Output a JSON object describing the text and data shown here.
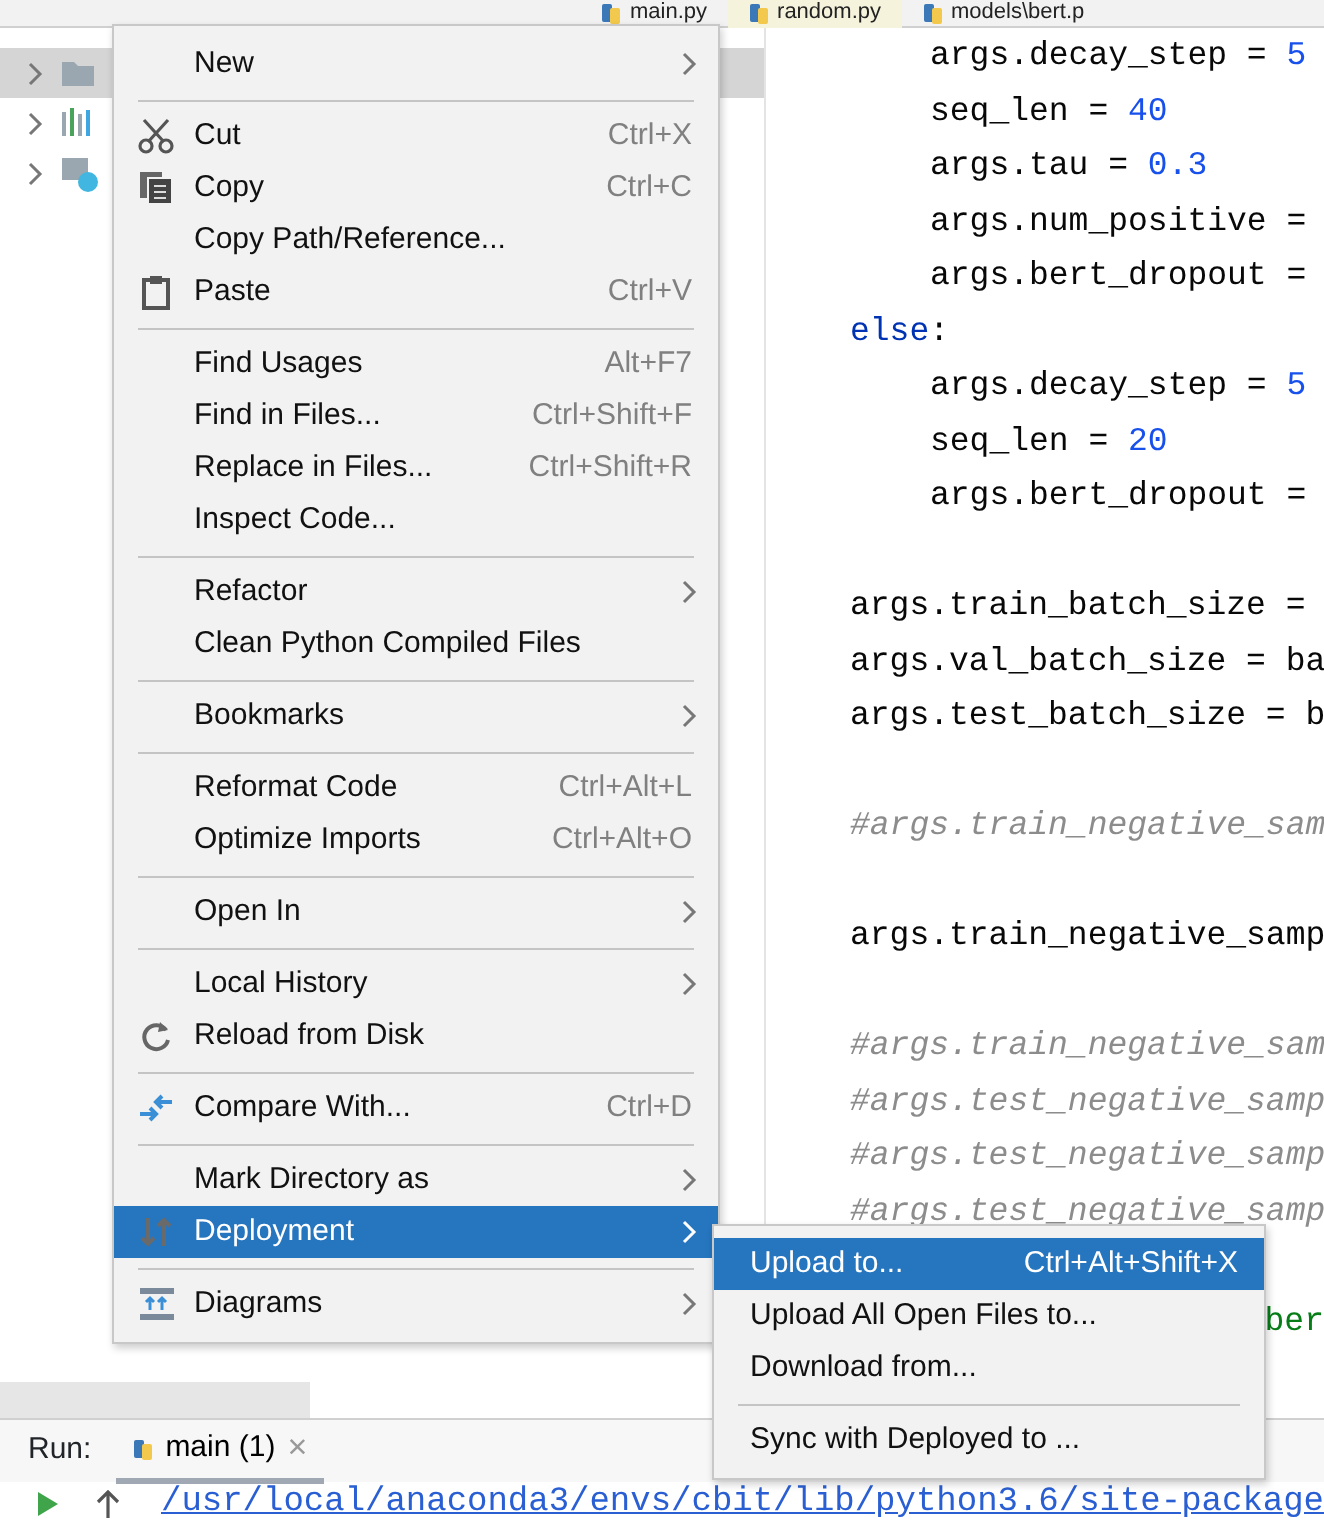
{
  "editor_tabs": [
    {
      "label": "main.py",
      "selected": false
    },
    {
      "label": "random.py",
      "selected": true
    },
    {
      "label": "models\\bert.p",
      "selected": false
    }
  ],
  "project_tree": [
    {
      "selected": true
    },
    {
      "selected": false
    },
    {
      "selected": false
    }
  ],
  "code_lines": [
    {
      "kind": "block",
      "children": [
        {
          "kind": "code",
          "tokens": [
            {
              "kind": "plain",
              "text": "args.decay_step = "
            },
            {
              "kind": "number",
              "text": "5"
            }
          ]
        },
        {
          "kind": "code",
          "tokens": [
            {
              "kind": "plain",
              "text": "seq_len = "
            },
            {
              "kind": "number",
              "text": "40"
            }
          ]
        },
        {
          "kind": "code",
          "tokens": [
            {
              "kind": "plain",
              "text": "args.tau = "
            },
            {
              "kind": "number",
              "text": "0.3"
            }
          ]
        },
        {
          "kind": "code",
          "tokens": [
            {
              "kind": "plain",
              "text": "args.num_positive ="
            }
          ]
        },
        {
          "kind": "code",
          "tokens": [
            {
              "kind": "plain",
              "text": "args.bert_dropout ="
            }
          ]
        }
      ]
    },
    {
      "kind": "code",
      "tokens": [
        {
          "kind": "keyword",
          "text": "else"
        },
        {
          "kind": "plain",
          "text": ":"
        }
      ],
      "children": [
        {
          "kind": "code",
          "tokens": [
            {
              "kind": "plain",
              "text": "args.decay_step = "
            },
            {
              "kind": "number",
              "text": "5"
            }
          ]
        },
        {
          "kind": "code",
          "tokens": [
            {
              "kind": "plain",
              "text": "seq_len = "
            },
            {
              "kind": "number",
              "text": "20"
            }
          ]
        },
        {
          "kind": "code",
          "tokens": [
            {
              "kind": "plain",
              "text": "args.bert_dropout ="
            }
          ]
        }
      ]
    },
    {
      "kind": "blank"
    },
    {
      "kind": "code",
      "tokens": [
        {
          "kind": "plain",
          "text": "args.train_batch_size ="
        }
      ]
    },
    {
      "kind": "code",
      "tokens": [
        {
          "kind": "plain",
          "text": "args.val_batch_size = ba"
        }
      ]
    },
    {
      "kind": "code",
      "tokens": [
        {
          "kind": "plain",
          "text": "args.test_batch_size = b"
        }
      ]
    },
    {
      "kind": "blank"
    },
    {
      "kind": "code",
      "tokens": [
        {
          "kind": "comment",
          "text": "#args.train_negative_sam"
        }
      ]
    },
    {
      "kind": "blank"
    },
    {
      "kind": "code",
      "tokens": [
        {
          "kind": "plain",
          "text": "args.train_negative_samp"
        }
      ]
    },
    {
      "kind": "blank"
    },
    {
      "kind": "code",
      "tokens": [
        {
          "kind": "comment",
          "text": "#args.train_negative_sam"
        }
      ]
    },
    {
      "kind": "code",
      "tokens": [
        {
          "kind": "comment",
          "text": "#args.test_negative_samp"
        }
      ]
    },
    {
      "kind": "code",
      "tokens": [
        {
          "kind": "comment",
          "text": "#args.test_negative_samp"
        }
      ]
    },
    {
      "kind": "code",
      "tokens": [
        {
          "kind": "comment",
          "text": "#args.test_negative_samp"
        }
      ]
    },
    {
      "kind": "blank"
    },
    {
      "kind": "partial",
      "tokens": [
        {
          "kind": "string",
          "text": "ber"
        }
      ]
    }
  ],
  "context_menu": [
    {
      "kind": "item",
      "label": "New",
      "submenu": true,
      "selected": false
    },
    {
      "kind": "separator"
    },
    {
      "kind": "item",
      "label": "Cut",
      "shortcut": "Ctrl+X",
      "selected": false
    },
    {
      "kind": "item",
      "label": "Copy",
      "shortcut": "Ctrl+C",
      "selected": false
    },
    {
      "kind": "item",
      "label": "Copy Path/Reference...",
      "selected": false
    },
    {
      "kind": "item",
      "label": "Paste",
      "shortcut": "Ctrl+V",
      "selected": false
    },
    {
      "kind": "separator"
    },
    {
      "kind": "item",
      "label": "Find Usages",
      "shortcut": "Alt+F7",
      "selected": false
    },
    {
      "kind": "item",
      "label": "Find in Files...",
      "shortcut": "Ctrl+Shift+F",
      "selected": false
    },
    {
      "kind": "item",
      "label": "Replace in Files...",
      "shortcut": "Ctrl+Shift+R",
      "selected": false
    },
    {
      "kind": "item",
      "label": "Inspect Code...",
      "selected": false
    },
    {
      "kind": "separator"
    },
    {
      "kind": "item",
      "label": "Refactor",
      "submenu": true,
      "selected": false
    },
    {
      "kind": "item",
      "label": "Clean Python Compiled Files",
      "selected": false
    },
    {
      "kind": "separator"
    },
    {
      "kind": "item",
      "label": "Bookmarks",
      "submenu": true,
      "selected": false
    },
    {
      "kind": "separator"
    },
    {
      "kind": "item",
      "label": "Reformat Code",
      "shortcut": "Ctrl+Alt+L",
      "selected": false
    },
    {
      "kind": "item",
      "label": "Optimize Imports",
      "shortcut": "Ctrl+Alt+O",
      "selected": false
    },
    {
      "kind": "separator"
    },
    {
      "kind": "item",
      "label": "Open In",
      "submenu": true,
      "selected": false
    },
    {
      "kind": "separator"
    },
    {
      "kind": "item",
      "label": "Local History",
      "submenu": true,
      "selected": false
    },
    {
      "kind": "item",
      "label": "Reload from Disk",
      "selected": false
    },
    {
      "kind": "separator"
    },
    {
      "kind": "item",
      "label": "Compare With...",
      "shortcut": "Ctrl+D",
      "selected": false
    },
    {
      "kind": "separator"
    },
    {
      "kind": "item",
      "label": "Mark Directory as",
      "submenu": true,
      "selected": false
    },
    {
      "kind": "item",
      "label": "Deployment",
      "submenu": true,
      "selected": true
    },
    {
      "kind": "separator"
    },
    {
      "kind": "item",
      "label": "Diagrams",
      "submenu": true,
      "selected": false
    }
  ],
  "deployment_submenu": [
    {
      "kind": "item",
      "label": "Upload to...",
      "shortcut": "Ctrl+Alt+Shift+X",
      "selected": true
    },
    {
      "kind": "item",
      "label": "Upload All Open Files to...",
      "selected": false
    },
    {
      "kind": "item",
      "label": "Download from...",
      "selected": false
    },
    {
      "kind": "separator"
    },
    {
      "kind": "item",
      "label": "Sync with Deployed to ...",
      "selected": false
    }
  ],
  "run_panel": {
    "label": "Run:",
    "tabs": [
      {
        "label": "main (1)",
        "close": "×",
        "selected": true
      }
    ],
    "console_line": "/usr/local/anaconda3/envs/cbit/lib/python3.6/site-package"
  }
}
